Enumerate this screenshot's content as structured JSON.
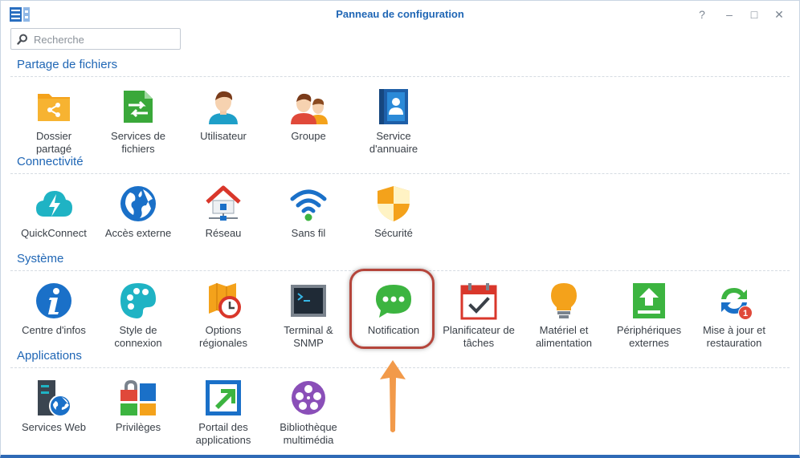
{
  "window": {
    "title": "Panneau de configuration",
    "buttons": {
      "help": "?",
      "minimize": "–",
      "maximize": "□",
      "close": "✕"
    }
  },
  "search": {
    "placeholder": "Recherche",
    "value": ""
  },
  "sections": {
    "partage": {
      "title": "Partage de fichiers",
      "items": {
        "dossier": {
          "line1": "Dossier",
          "line2": "partagé",
          "icon": "shared-folder-icon"
        },
        "services_fichiers": {
          "line1": "Services de",
          "line2": "fichiers",
          "icon": "file-services-icon"
        },
        "utilisateur": {
          "line1": "Utilisateur",
          "line2": "",
          "icon": "user-icon"
        },
        "groupe": {
          "line1": "Groupe",
          "line2": "",
          "icon": "group-icon"
        },
        "annuaire": {
          "line1": "Service",
          "line2": "d'annuaire",
          "icon": "directory-service-icon"
        }
      }
    },
    "connectivite": {
      "title": "Connectivité",
      "items": {
        "quickconnect": {
          "line1": "QuickConnect",
          "line2": "",
          "icon": "quickconnect-icon"
        },
        "acces_externe": {
          "line1": "Accès externe",
          "line2": "",
          "icon": "globe-icon"
        },
        "reseau": {
          "line1": "Réseau",
          "line2": "",
          "icon": "network-house-icon"
        },
        "sans_fil": {
          "line1": "Sans fil",
          "line2": "",
          "icon": "wifi-icon"
        },
        "securite": {
          "line1": "Sécurité",
          "line2": "",
          "icon": "shield-icon"
        }
      }
    },
    "systeme": {
      "title": "Système",
      "items": {
        "centre_infos": {
          "line1": "Centre d'infos",
          "line2": "",
          "icon": "info-icon"
        },
        "style_connexion": {
          "line1": "Style de",
          "line2": "connexion",
          "icon": "palette-icon"
        },
        "options_regionales": {
          "line1": "Options",
          "line2": "régionales",
          "icon": "regional-clock-icon"
        },
        "terminal": {
          "line1": "Terminal &",
          "line2": "SNMP",
          "icon": "terminal-icon"
        },
        "notification": {
          "line1": "Notification",
          "line2": "",
          "icon": "chat-bubble-icon"
        },
        "planificateur": {
          "line1": "Planificateur de",
          "line2": "tâches",
          "icon": "calendar-check-icon"
        },
        "materiel": {
          "line1": "Matériel et",
          "line2": "alimentation",
          "icon": "lightbulb-icon"
        },
        "peripheriques": {
          "line1": "Périphériques",
          "line2": "externes",
          "icon": "upload-device-icon"
        },
        "mise_a_jour": {
          "line1": "Mise à jour et",
          "line2": "restauration",
          "icon": "update-arrows-icon",
          "badge": "1"
        }
      }
    },
    "applications": {
      "title": "Applications",
      "items": {
        "services_web": {
          "line1": "Services Web",
          "line2": "",
          "icon": "web-server-icon"
        },
        "privileges": {
          "line1": "Privilèges",
          "line2": "",
          "icon": "privileges-lock-icon"
        },
        "portail": {
          "line1": "Portail des",
          "line2": "applications",
          "icon": "portal-arrow-icon"
        },
        "bibliotheque": {
          "line1": "Bibliothèque",
          "line2": "multimédia",
          "icon": "film-reel-icon"
        }
      }
    }
  },
  "colors": {
    "section_title": "#1f66b5",
    "highlight_ring": "#b5453b",
    "annotation_arrow": "#f29a4a",
    "window_border": "#2f6ab6"
  }
}
